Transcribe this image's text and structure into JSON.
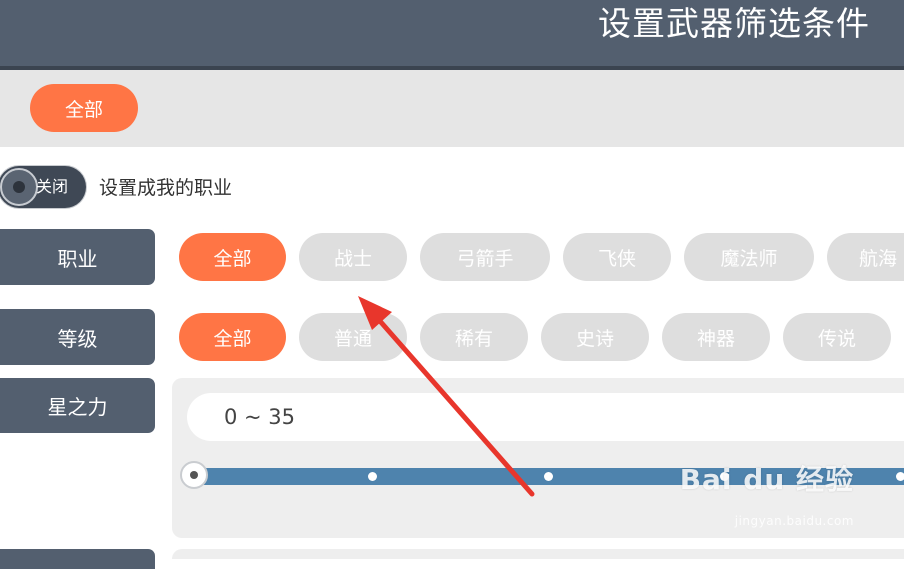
{
  "header": {
    "title": "设置武器筛选条件"
  },
  "type_filter": {
    "all_label": "全部"
  },
  "toggle": {
    "state_label": "关闭",
    "description": "设置成我的职业"
  },
  "job": {
    "label": "职业",
    "options": [
      "全部",
      "战士",
      "弓箭手",
      "飞侠",
      "魔法师",
      "航海"
    ],
    "selected": "全部"
  },
  "grade": {
    "label": "等级",
    "options": [
      "全部",
      "普通",
      "稀有",
      "史诗",
      "神器",
      "传说"
    ],
    "selected": "全部"
  },
  "star": {
    "label": "星之力",
    "range_text": "0 ~ 35",
    "min": 0,
    "max": 35
  },
  "watermark": {
    "brand": "Bai du 经验",
    "url": "jingyan.baidu.com"
  },
  "colors": {
    "header": "#535f6f",
    "accent": "#ff7545",
    "pill_inactive": "#dedede",
    "slider": "#4e83ad",
    "arrow": "#e8362c"
  }
}
